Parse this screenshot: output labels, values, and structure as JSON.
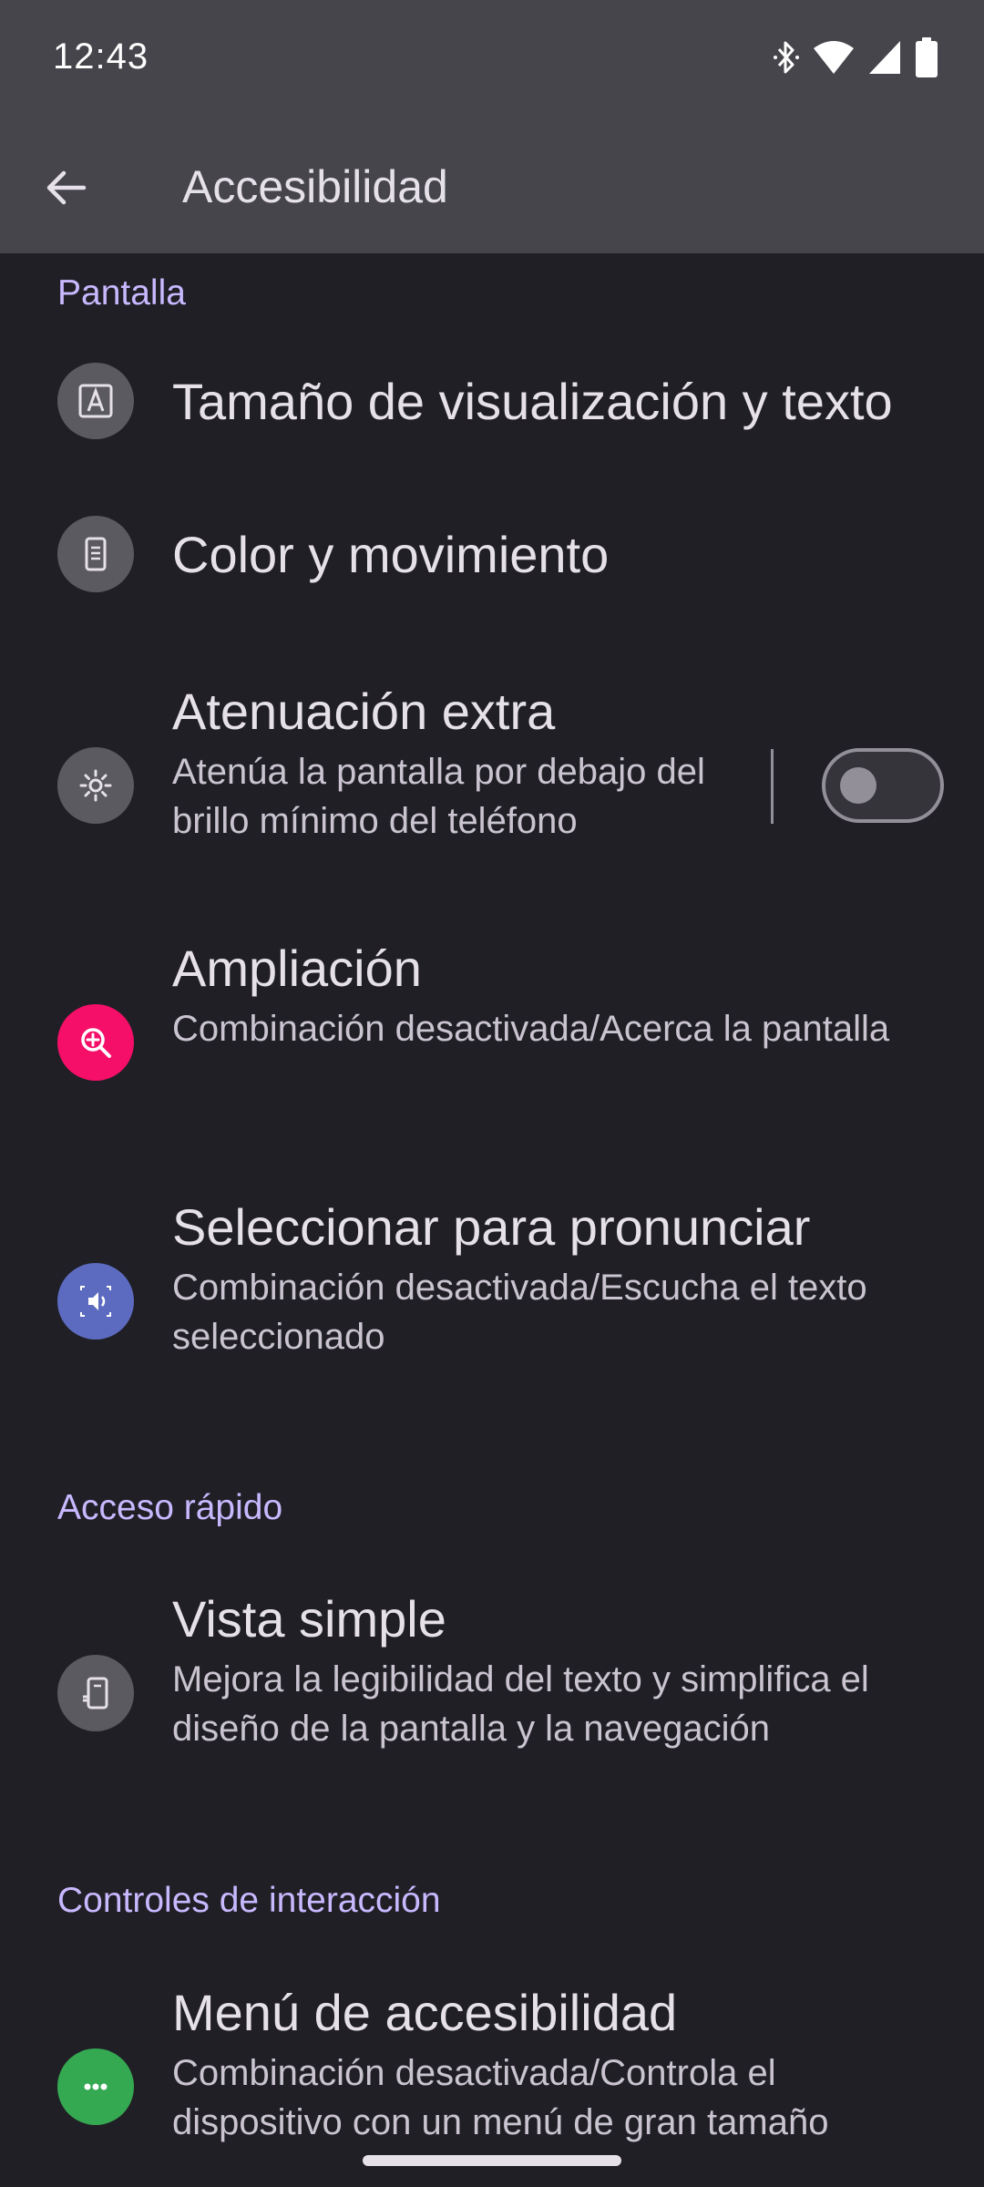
{
  "status_bar": {
    "time": "12:43",
    "icons": [
      "bluetooth-icon",
      "wifi-icon",
      "signal-icon",
      "battery-icon"
    ]
  },
  "app_bar": {
    "title": "Accesibilidad",
    "back_icon": "arrow-back-icon"
  },
  "sections": {
    "pantalla": "Pantalla",
    "acceso_rapido": "Acceso rápido",
    "controles": "Controles de interacción"
  },
  "items": {
    "tamano": {
      "title": "Tamaño de visualización y texto",
      "icon": "text-size-icon"
    },
    "color": {
      "title": "Color y movimiento",
      "icon": "phone-color-icon"
    },
    "atenuacion": {
      "title": "Atenuación extra",
      "summary": "Atenúa la pantalla por debajo del brillo mínimo del teléfono",
      "icon": "brightness-icon",
      "toggle_on": false
    },
    "ampliacion": {
      "title": "Ampliación",
      "summary": "Combinación desactivada/Acerca la pantalla",
      "icon": "zoom-in-icon"
    },
    "seleccionar": {
      "title": "Seleccionar para pronunciar",
      "summary": "Combinación desactivada/Escucha el texto seleccionado",
      "icon": "speaker-icon"
    },
    "vista_simple": {
      "title": "Vista simple",
      "summary": "Mejora la legibilidad del texto y simplifica el diseño de la pantalla y la navegación",
      "icon": "simple-view-icon"
    },
    "menu_accesibilidad": {
      "title": "Menú de accesibilidad",
      "summary": "Combinación desactivada/Controla el dispositivo con un menú de gran tamaño",
      "icon": "more-dots-icon"
    }
  },
  "colors": {
    "background": "#201f25",
    "app_bar": "#46454c",
    "section_header": "#c8b9ff",
    "icon_gray": "#5b5a60",
    "icon_pink": "#f50f68",
    "icon_indigo": "#5c6bc0",
    "icon_green": "#35a852"
  }
}
